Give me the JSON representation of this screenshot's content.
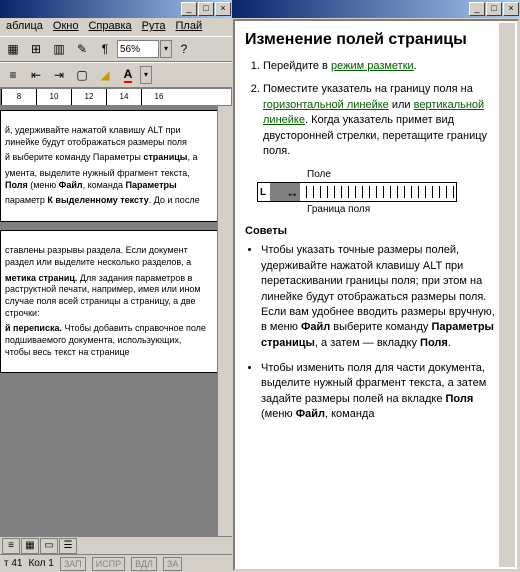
{
  "left_window": {
    "menu": [
      "аблица",
      "Окно",
      "Справка",
      "Рута",
      "Плай"
    ],
    "zoom": "56%",
    "ruler_marks": [
      "8",
      "10",
      "12",
      "14",
      "16"
    ],
    "page1": {
      "p1": "й, удерживайте нажатой клавишу ALT при линейке будут отображаться размеры поля",
      "p2": {
        "pre": "й выберите команду Параметры ",
        "bold": "страницы",
        "post": ", а"
      },
      "p3": {
        "pre": "умента, выделите нужный фрагмент текста, ",
        "bold1": "Поля",
        "mid": " (меню ",
        "bold2": "Файл",
        "mid2": ", команда ",
        "bold3": "Параметры"
      },
      "p4": {
        "pre": "параметр ",
        "bold": "К выделенному тексту",
        "post": ". До и после"
      }
    },
    "page2": {
      "p1": "ставлены разрывы раздела. Если документ раздел или выделите несколько разделов, а",
      "p2": {
        "bold": "метика страниц.",
        "post": "    Для задания параметров в раструктной печати, например, имея или ином случае поля всей страницы а страницу, а две строчки:"
      },
      "p3": {
        "bold": "й переписка.",
        "post": " Чтобы добавить справочное поле подшиваемого документа, использующих, чтобы весь текст на странице"
      }
    },
    "status": {
      "page": "т  41",
      "col": "Кол  1",
      "cells": [
        "ЗАП",
        "ИСПР",
        "ВДЛ",
        "ЗА"
      ]
    }
  },
  "help": {
    "title": "Изменение полей страницы",
    "step1": {
      "pre": "Перейдите в ",
      "link": "режим разметки",
      "post": "."
    },
    "step2": {
      "pre": "Поместите указатель на границу поля на ",
      "link1": "горизонтальной линейке",
      "mid": " или ",
      "link2": "вертикальной линейке",
      "post": ". Когда указатель примет вид двусторонней стрелки, перетащите границу поля."
    },
    "ruler": {
      "label_top": "Поле",
      "label_bottom": "Граница поля"
    },
    "tips_heading": "Советы",
    "tip1": {
      "t1": "Чтобы указать точные размеры полей, удерживайте нажатой клавишу ALT при перетаскивании границы поля; при этом на линейке будут отображаться размеры поля. Если вам удобнее вводить размеры вручную, в меню ",
      "b1": "Файл",
      "t2": " выберите команду ",
      "b2": "Параметры страницы",
      "t3": ", а затем — вкладку ",
      "b3": "Поля",
      "t4": "."
    },
    "tip2": {
      "t1": "Чтобы изменить поля для части документа, выделите нужный фрагмент текста, а затем задайте размеры полей на вкладке ",
      "b1": "Поля",
      "t2": " (меню ",
      "b2": "Файл",
      "t3": ", команда"
    }
  }
}
